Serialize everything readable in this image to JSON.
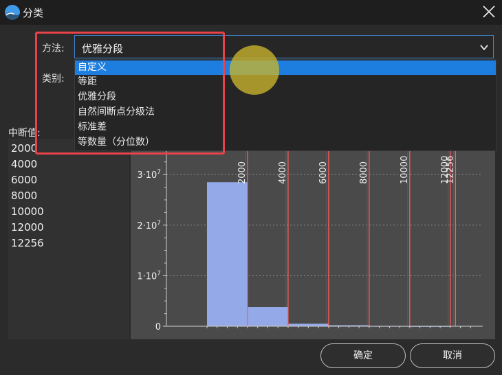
{
  "window": {
    "title": "分类",
    "logo_icon": "app-logo-icon",
    "close_icon": "close-icon"
  },
  "method": {
    "label": "方法:",
    "selected": "优雅分段",
    "options": [
      "自定义",
      "等距",
      "优雅分段",
      "自然间断点分级法",
      "标准差",
      "等数量（分位数）"
    ],
    "highlighted_index": 0
  },
  "category": {
    "label": "类别:"
  },
  "breaks": {
    "label": "中断值:",
    "values": [
      "2000",
      "4000",
      "6000",
      "8000",
      "10000",
      "12000",
      "12256"
    ]
  },
  "chart_data": {
    "type": "bar",
    "title": "",
    "xlabel": "",
    "ylabel": "",
    "bins": [
      {
        "x_start": 0,
        "x_end": 2000,
        "value": 28500000
      },
      {
        "x_start": 2000,
        "x_end": 4000,
        "value": 3800000
      },
      {
        "x_start": 4000,
        "x_end": 6000,
        "value": 500000
      },
      {
        "x_start": 6000,
        "x_end": 8000,
        "value": 200000
      },
      {
        "x_start": 8000,
        "x_end": 10000,
        "value": 50000
      },
      {
        "x_start": 10000,
        "x_end": 12000,
        "value": 20000
      },
      {
        "x_start": 12000,
        "x_end": 12256,
        "value": 0
      }
    ],
    "break_lines": [
      2000,
      4000,
      6000,
      8000,
      10000,
      12000,
      12256
    ],
    "break_labels": [
      "2000",
      "4000",
      "6000",
      "8000",
      "10000",
      "12000",
      "12256"
    ],
    "y_ticks": [
      {
        "value": 0,
        "label": "0",
        "exp": ""
      },
      {
        "value": 10000000,
        "label": "1·10",
        "exp": "7"
      },
      {
        "value": 20000000,
        "label": "2·10",
        "exp": "7"
      },
      {
        "value": 30000000,
        "label": "3·10",
        "exp": "7"
      }
    ],
    "xlim": [
      -2000,
      13600
    ],
    "ylim": [
      0,
      36000000
    ],
    "grid": true,
    "colors": {
      "bar": "#94aae8",
      "break_line": "#ff5c5c",
      "grid": "#8a8a8a",
      "axis": "#d0d0d0"
    }
  },
  "buttons": {
    "ok": "确定",
    "cancel": "取消"
  },
  "colors": {
    "accent": "#1e7ee0",
    "highlight_outline": "#e8424a",
    "pointer": "#c9b52c"
  }
}
